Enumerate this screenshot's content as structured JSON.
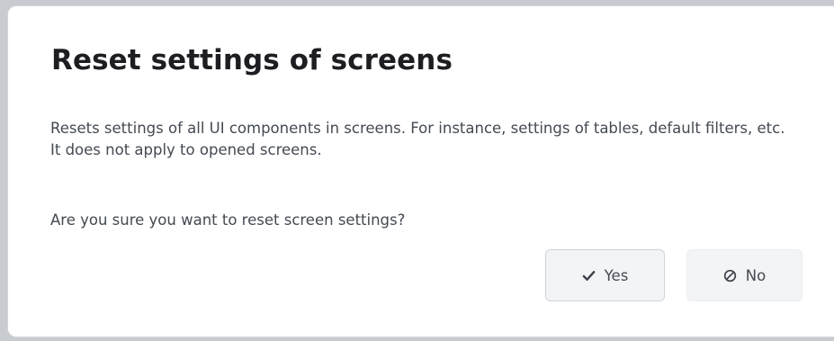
{
  "dialog": {
    "title": "Reset settings of screens",
    "description": "Resets settings of all UI components in screens. For instance, settings of tables, default filters, etc. It does not apply to opened screens.",
    "question": "Are you sure you want to reset screen settings?",
    "buttons": {
      "yes": {
        "label": "Yes",
        "icon": "checkmark-icon"
      },
      "no": {
        "label": "No",
        "icon": "ban-icon"
      }
    }
  },
  "colors": {
    "background": "#ffffff",
    "title_text": "#1e1e22",
    "body_text": "#444a52",
    "button_background": "#f3f4f5",
    "button_border": "#d0d3d7"
  }
}
